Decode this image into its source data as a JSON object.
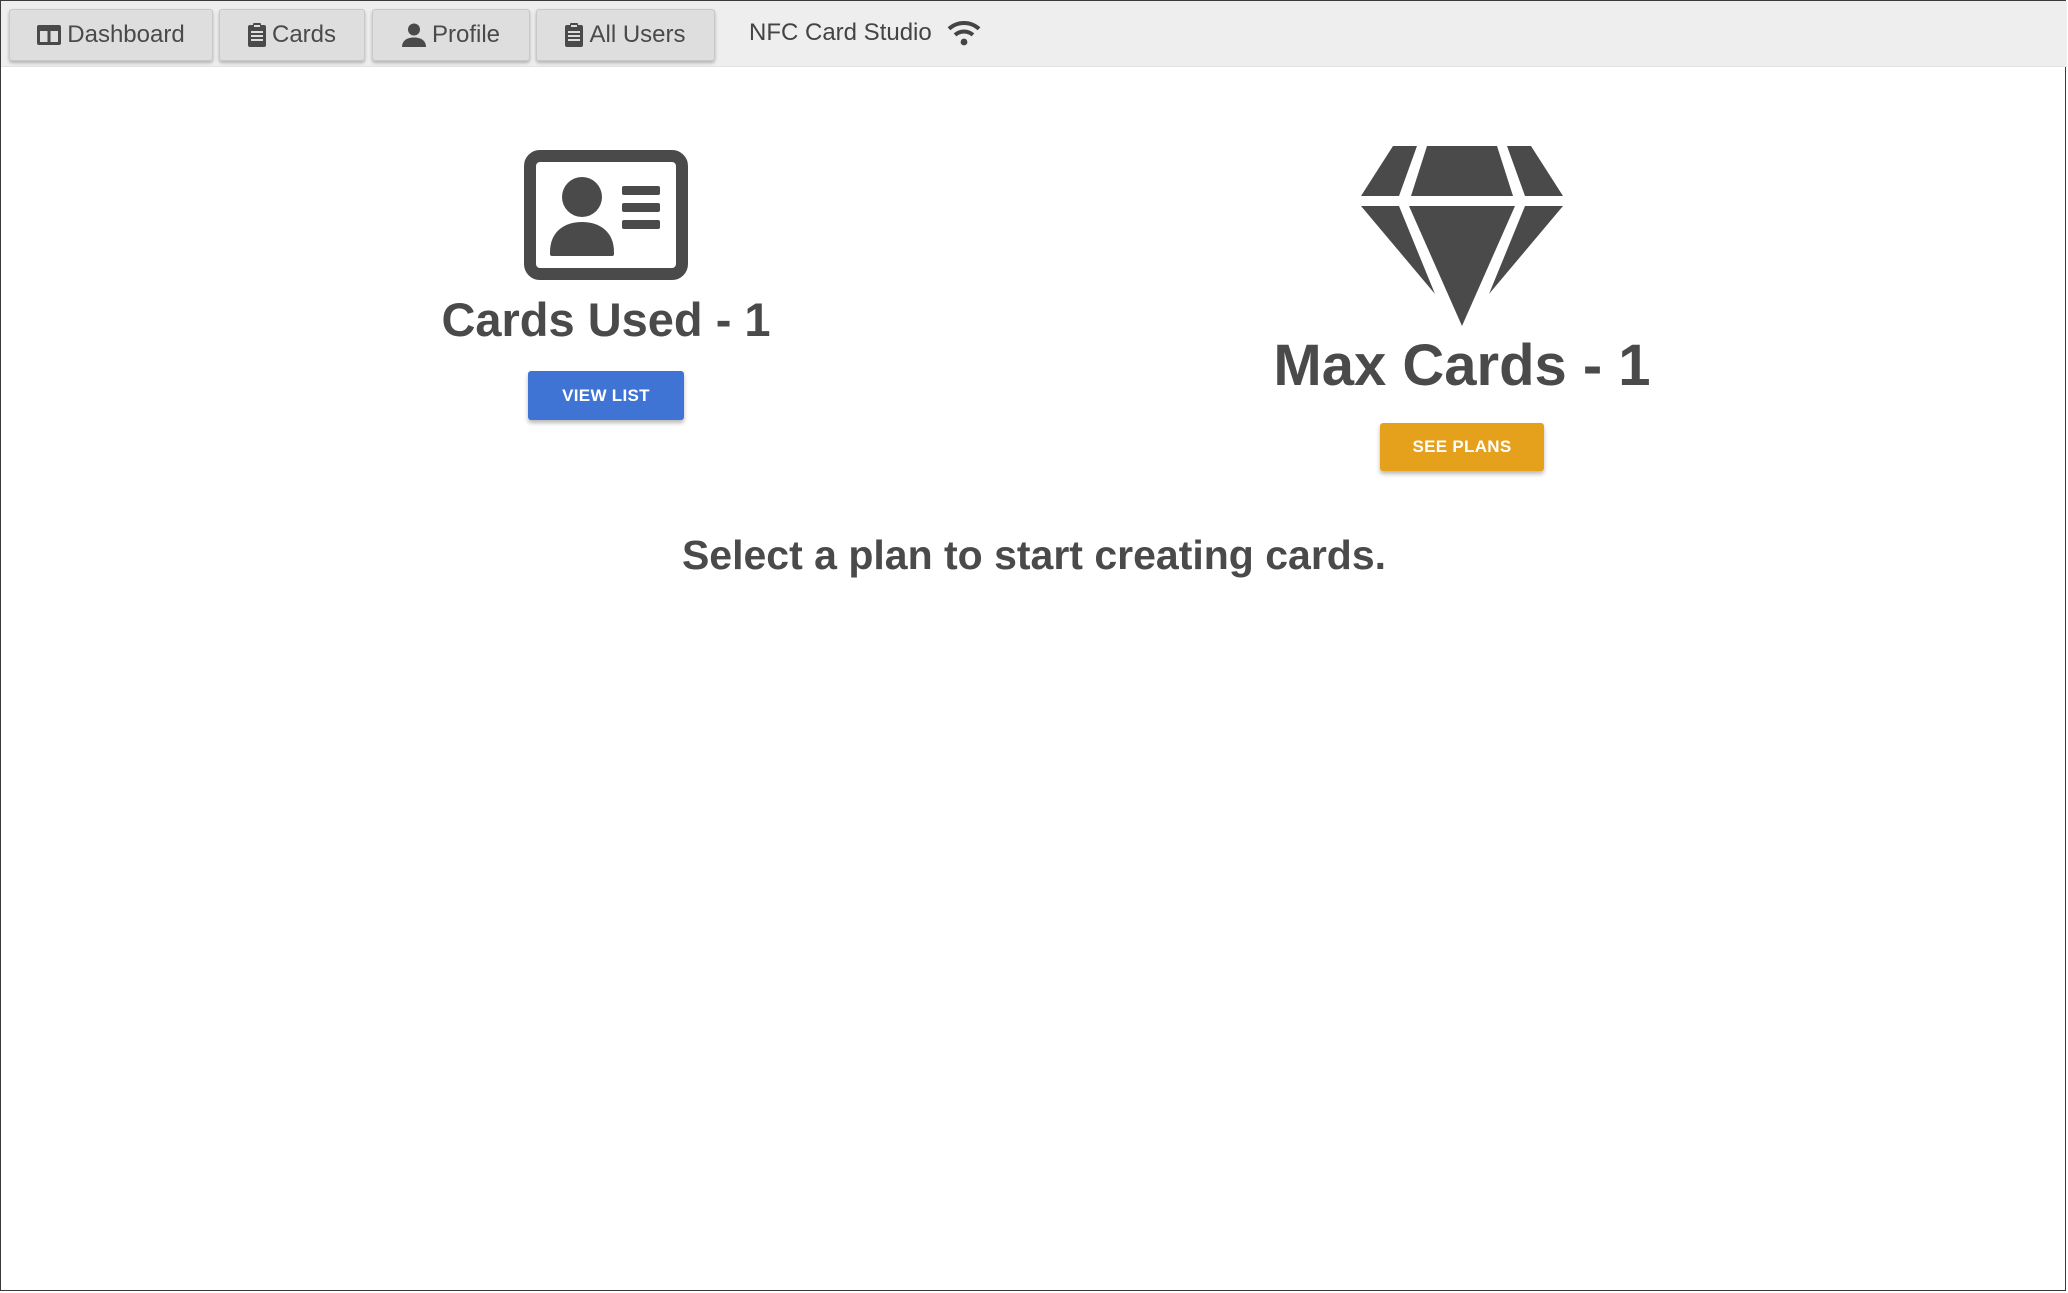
{
  "nav": {
    "items": [
      {
        "label": "Dashboard",
        "icon": "columns-icon"
      },
      {
        "label": "Cards",
        "icon": "clipboard-icon"
      },
      {
        "label": "Profile",
        "icon": "user-icon"
      },
      {
        "label": "All Users",
        "icon": "clipboard-icon"
      }
    ],
    "brand": "NFC Card Studio",
    "brand_icon": "wifi-icon"
  },
  "stats": {
    "used": {
      "title": "Cards Used - 1",
      "button_label": "VIEW LIST",
      "icon": "id-card-icon",
      "button_color": "#3f74d4"
    },
    "max": {
      "title": "Max Cards - 1",
      "button_label": "SEE PLANS",
      "icon": "gem-icon",
      "button_color": "#e5a01c"
    }
  },
  "message": "Select a plan to start creating cards."
}
